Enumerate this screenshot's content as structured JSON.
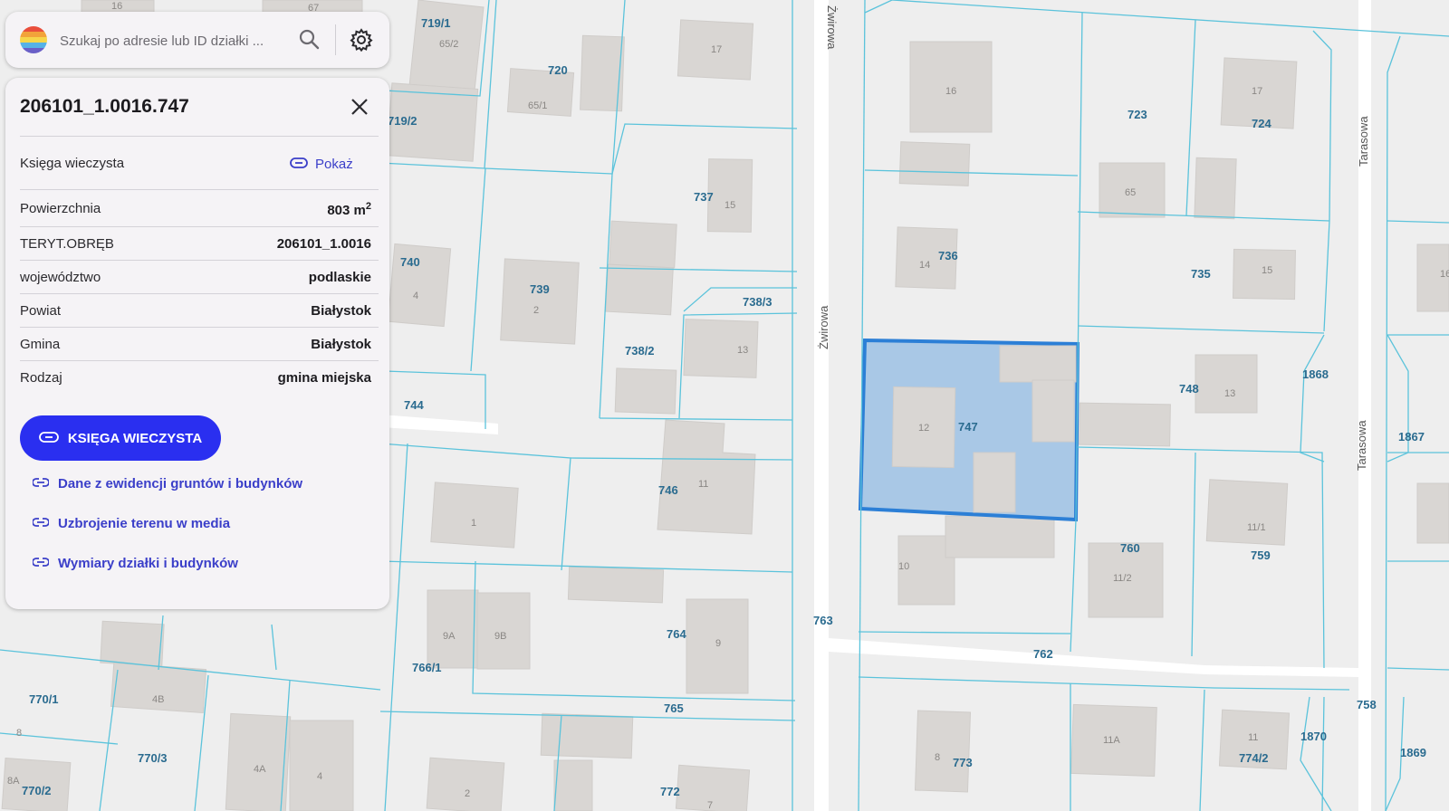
{
  "search": {
    "placeholder": "Szukaj po adresie lub ID działki ..."
  },
  "colors": {
    "accent": "#2a2ff0",
    "link": "#3b3fc9",
    "selected_parcel_fill": "#a9c8e6",
    "selected_parcel_stroke": "#2c7fd6",
    "parcel_line": "#5bc3db"
  },
  "icons": {
    "logo": "rainbow-circle-logo",
    "search": "search-icon",
    "settings": "gear-icon",
    "close": "close-icon",
    "link": "link-icon"
  },
  "panel": {
    "title": "206101_1.0016.747",
    "land_register": {
      "label": "Księga wieczysta",
      "action": "Pokaż"
    },
    "rows": [
      {
        "label": "Powierzchnia",
        "value": "803 m",
        "sup": "2"
      },
      {
        "label": "TERYT.OBRĘB",
        "value": "206101_1.0016"
      },
      {
        "label": "województwo",
        "value": "podlaskie"
      },
      {
        "label": "Powiat",
        "value": "Białystok"
      },
      {
        "label": "Gmina",
        "value": "Białystok"
      },
      {
        "label": "Rodzaj",
        "value": "gmina miejska"
      }
    ],
    "main_button": "KSIĘGA WIECZYSTA",
    "links": [
      "Dane z ewidencji gruntów i budynków",
      "Uzbrojenie terenu w media",
      "Wymiary działki i budynków"
    ]
  },
  "map": {
    "streets": [
      "Żwirowa",
      "Żwirowa",
      "Tarasowa",
      "Tarasowa"
    ],
    "parcel_labels": [
      "719/1",
      "720",
      "719/2",
      "737",
      "740",
      "739",
      "738/3",
      "738/2",
      "744",
      "746",
      "723",
      "724",
      "736",
      "735",
      "747",
      "748",
      "1868",
      "1867",
      "760",
      "759",
      "763",
      "762",
      "764",
      "766/1",
      "765",
      "770/1",
      "770/3",
      "770/2",
      "772",
      "773",
      "774/2",
      "1870",
      "758",
      "1869"
    ],
    "building_numbers": [
      "16",
      "67",
      "65/2",
      "65/1",
      "17",
      "15",
      "4",
      "2",
      "13",
      "11",
      "1",
      "9A",
      "9B",
      "9",
      "4B",
      "4A",
      "4",
      "8A",
      "8",
      "2",
      "7",
      "16",
      "17",
      "65",
      "14",
      "15",
      "13",
      "12",
      "10",
      "11/1",
      "11/2",
      "11A",
      "8",
      "11",
      "16"
    ]
  }
}
